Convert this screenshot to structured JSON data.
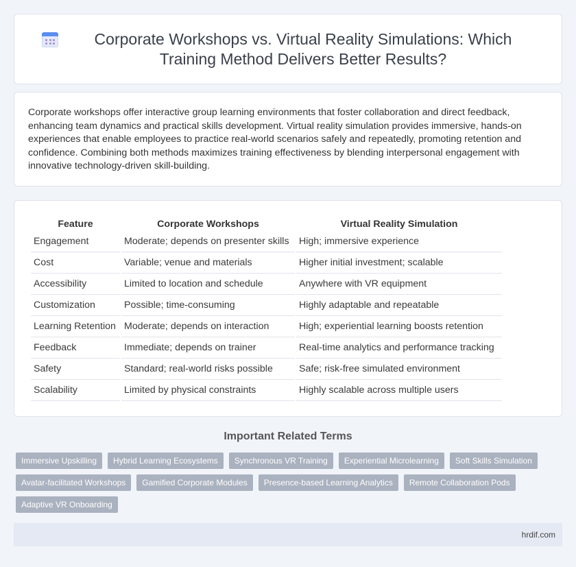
{
  "header": {
    "title": "Corporate Workshops vs. Virtual Reality Simulations: Which Training Method Delivers Better Results?",
    "icon": "calendar-icon"
  },
  "summary": "Corporate workshops offer interactive group learning environments that foster collaboration and direct feedback, enhancing team dynamics and practical skills development. Virtual reality simulation provides immersive, hands-on experiences that enable employees to practice real-world scenarios safely and repeatedly, promoting retention and confidence. Combining both methods maximizes training effectiveness by blending interpersonal engagement with innovative technology-driven skill-building.",
  "table": {
    "headers": [
      "Feature",
      "Corporate Workshops",
      "Virtual Reality Simulation"
    ],
    "rows": [
      [
        "Engagement",
        "Moderate; depends on presenter skills",
        "High; immersive experience"
      ],
      [
        "Cost",
        "Variable; venue and materials",
        "Higher initial investment; scalable"
      ],
      [
        "Accessibility",
        "Limited to location and schedule",
        "Anywhere with VR equipment"
      ],
      [
        "Customization",
        "Possible; time-consuming",
        "Highly adaptable and repeatable"
      ],
      [
        "Learning Retention",
        "Moderate; depends on interaction",
        "High; experiential learning boosts retention"
      ],
      [
        "Feedback",
        "Immediate; depends on trainer",
        "Real-time analytics and performance tracking"
      ],
      [
        "Safety",
        "Standard; real-world risks possible",
        "Safe; risk-free simulated environment"
      ],
      [
        "Scalability",
        "Limited by physical constraints",
        "Highly scalable across multiple users"
      ]
    ]
  },
  "related": {
    "title": "Important Related Terms",
    "tags": [
      "Immersive Upskilling",
      "Hybrid Learning Ecosystems",
      "Synchronous VR Training",
      "Experiential Microlearning",
      "Soft Skills Simulation",
      "Avatar-facilitated Workshops",
      "Gamified Corporate Modules",
      "Presence-based Learning Analytics",
      "Remote Collaboration Pods",
      "Adaptive VR Onboarding"
    ]
  },
  "footer": {
    "site": "hrdif.com"
  }
}
